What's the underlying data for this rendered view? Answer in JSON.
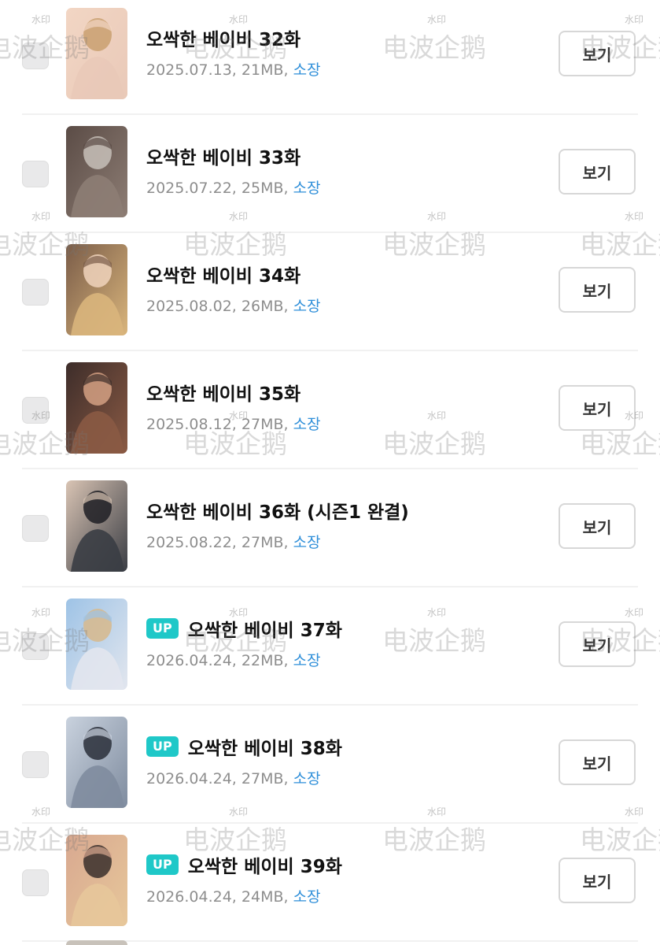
{
  "episodes": [
    {
      "title": "오싹한 베이비 32화",
      "date": "2025.07.13",
      "size": "21MB",
      "owned_label": "소장",
      "view_label": "보기",
      "up": false,
      "thumb_palette": [
        "#e9c9b8",
        "#c9a070",
        "#f2d6c4"
      ],
      "thumb_icon": "episode-32-thumbnail-icon"
    },
    {
      "title": "오싹한 베이비 33화",
      "date": "2025.07.22",
      "size": "25MB",
      "owned_label": "소장",
      "view_label": "보기",
      "up": false,
      "thumb_palette": [
        "#8d7d74",
        "#c7c0b8",
        "#5b4c46"
      ],
      "thumb_icon": "episode-33-thumbnail-icon"
    },
    {
      "title": "오싹한 베이비 34화",
      "date": "2025.08.02",
      "size": "26MB",
      "owned_label": "소장",
      "view_label": "보기",
      "up": false,
      "thumb_palette": [
        "#d9b57c",
        "#f0d3bc",
        "#7a5c48"
      ],
      "thumb_icon": "episode-34-thumbnail-icon"
    },
    {
      "title": "오싹한 베이비 35화",
      "date": "2025.08.12",
      "size": "27MB",
      "owned_label": "소장",
      "view_label": "보기",
      "up": false,
      "thumb_palette": [
        "#8a5a44",
        "#d4a082",
        "#3d2d2a"
      ],
      "thumb_icon": "episode-35-thumbnail-icon"
    },
    {
      "title": "오싹한 베이비 36화 (시즌1 완결)",
      "date": "2025.08.22",
      "size": "27MB",
      "owned_label": "소장",
      "view_label": "보기",
      "up": false,
      "thumb_palette": [
        "#3a3d44",
        "#1e1f24",
        "#d9c4b4"
      ],
      "thumb_icon": "episode-36-thumbnail-icon"
    },
    {
      "title": "오싹한 베이비 37화",
      "date": "2026.04.24",
      "size": "22MB",
      "owned_label": "소장",
      "view_label": "보기",
      "up": true,
      "up_label": "UP",
      "thumb_palette": [
        "#e2e6ee",
        "#d7b88c",
        "#9ec3e6"
      ],
      "thumb_icon": "episode-37-thumbnail-icon"
    },
    {
      "title": "오싹한 베이비 38화",
      "date": "2026.04.24",
      "size": "27MB",
      "owned_label": "소장",
      "view_label": "보기",
      "up": true,
      "up_label": "UP",
      "thumb_palette": [
        "#7f8c9f",
        "#2a2f3a",
        "#c9d2de"
      ],
      "thumb_icon": "episode-38-thumbnail-icon"
    },
    {
      "title": "오싹한 베이비 39화",
      "date": "2026.04.24",
      "size": "24MB",
      "owned_label": "소장",
      "view_label": "보기",
      "up": true,
      "up_label": "UP",
      "thumb_palette": [
        "#e7c79a",
        "#3a2f2c",
        "#d8a890"
      ],
      "thumb_icon": "episode-39-thumbnail-icon"
    }
  ],
  "watermark": {
    "large_text": "电波企鹅",
    "small_text": "水印"
  }
}
